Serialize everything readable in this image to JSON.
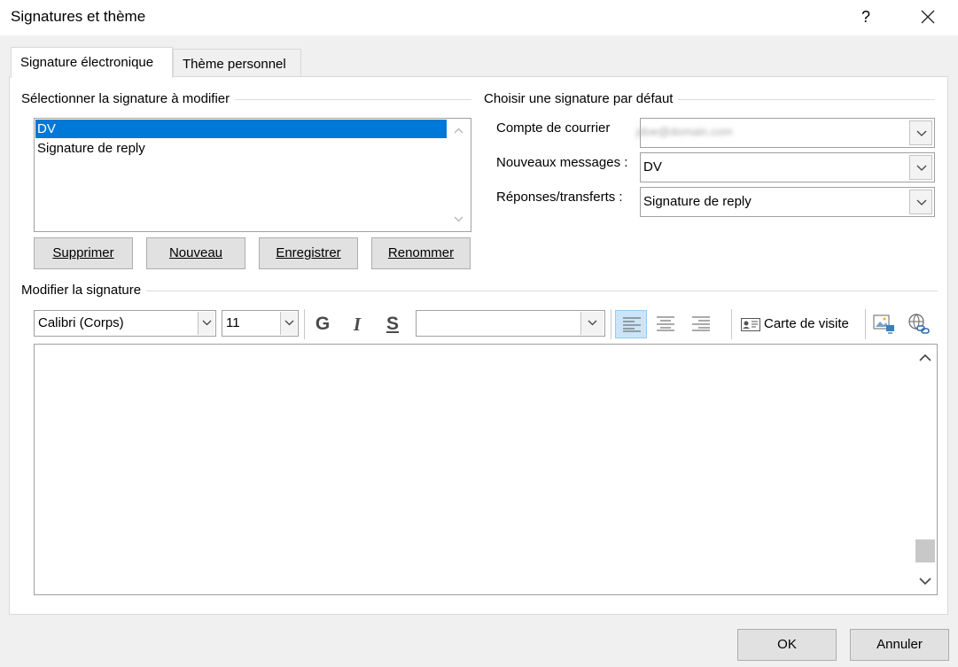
{
  "window": {
    "title": "Signatures et thème",
    "help_label": "?"
  },
  "tabs": [
    {
      "label": "Signature électronique",
      "active": true
    },
    {
      "label": "Thème personnel",
      "active": false
    }
  ],
  "select_section": {
    "title": "Sélectionner la signature à modifier",
    "signatures": [
      "DV",
      "Signature de reply"
    ],
    "selected_index": 0,
    "buttons": {
      "delete": "Supprimer",
      "new": "Nouveau",
      "save": "Enregistrer",
      "rename": "Renommer"
    }
  },
  "default_section": {
    "title": "Choisir une signature par défaut",
    "account_label": "Compte de courrier",
    "account_value": "jdoe@domain.com",
    "new_messages_label": "Nouveaux messages :",
    "new_messages_value": "DV",
    "replies_label": "Réponses/transferts :",
    "replies_value": "Signature de reply"
  },
  "edit_section": {
    "title": "Modifier la signature",
    "font_value": "Calibri (Corps)",
    "size_value": "11",
    "bold_label": "G",
    "italic_label": "I",
    "underline_label": "S",
    "color_value": "",
    "business_card_label": "Carte de visite",
    "active_alignment": "left"
  },
  "footer": {
    "ok_label": "OK",
    "cancel_label": "Annuler"
  },
  "colors": {
    "selection": "#0078d7",
    "active_align_bg": "#cce4f7"
  },
  "icons": [
    "close-icon",
    "chevron-up-icon",
    "chevron-down-icon",
    "dropdown-arrow-icon",
    "align-left-icon",
    "align-center-icon",
    "align-right-icon",
    "business-card-icon",
    "insert-picture-icon",
    "hyperlink-icon"
  ]
}
